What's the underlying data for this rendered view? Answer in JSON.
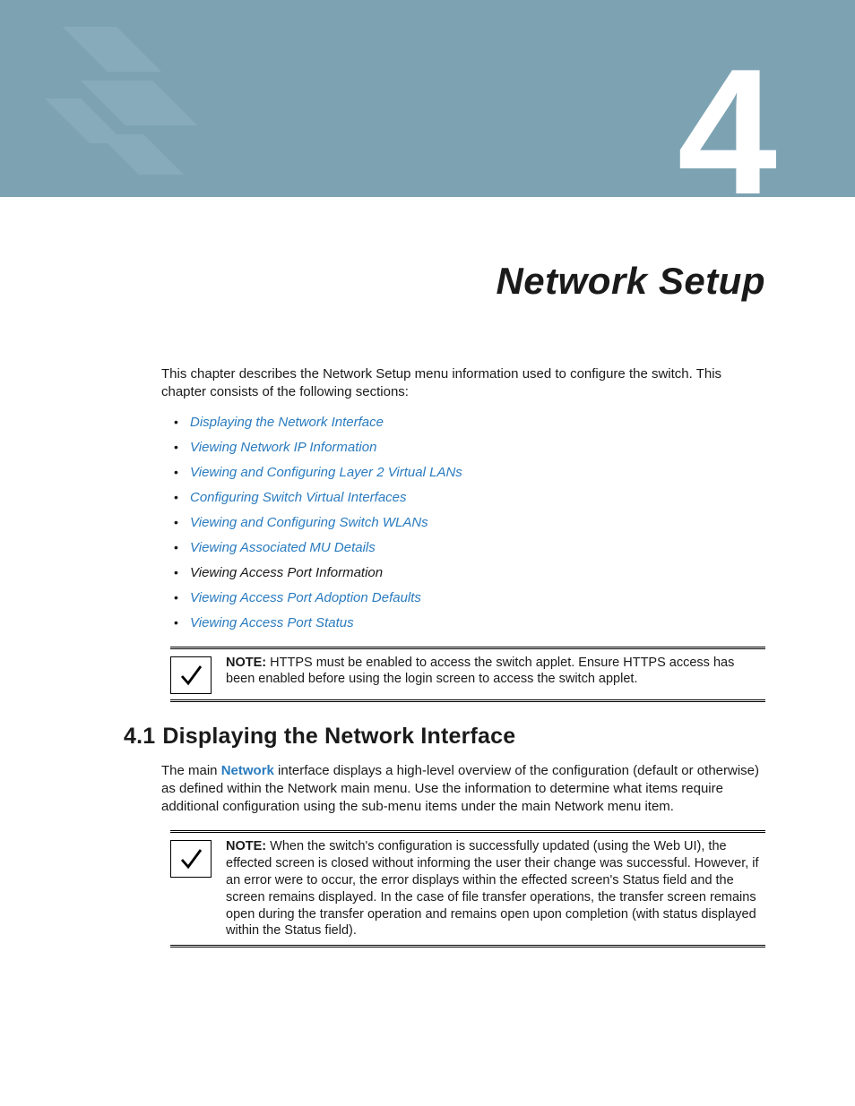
{
  "chapter": {
    "number": "4",
    "title": "Network Setup",
    "intro": "This chapter describes the Network Setup menu information used to configure the switch. This chapter consists of the following sections:"
  },
  "toc": [
    {
      "label": "Displaying the Network Interface",
      "link": true
    },
    {
      "label": "Viewing Network IP Information",
      "link": true
    },
    {
      "label": "Viewing and Configuring Layer 2 Virtual LANs",
      "link": true
    },
    {
      "label": "Configuring Switch Virtual Interfaces",
      "link": true
    },
    {
      "label": "Viewing and Configuring Switch WLANs",
      "link": true
    },
    {
      "label": "Viewing Associated MU Details",
      "link": true
    },
    {
      "label": "Viewing Access Port Information",
      "link": false
    },
    {
      "label": "Viewing Access Port Adoption Defaults",
      "link": true
    },
    {
      "label": "Viewing Access Port Status",
      "link": true
    }
  ],
  "note1": {
    "label": "NOTE:",
    "text": " HTTPS must be enabled to access the switch applet. Ensure HTTPS access has been enabled before using the login screen to access the switch applet."
  },
  "section41": {
    "number": "4.1",
    "title": "Displaying the Network Interface",
    "para_pre": "The main ",
    "para_kw": "Network",
    "para_post": " interface displays a high-level overview of the configuration (default or otherwise) as defined within the Network main menu. Use the information to determine what items require additional configuration using the sub-menu items under the main Network menu item."
  },
  "note2": {
    "label": "NOTE:",
    "text": " When the switch's configuration is successfully updated (using the Web UI), the effected screen is closed without informing the user their change was successful. However, if an error were to occur, the error displays within the effected screen's Status field and the screen remains displayed. In the case of file transfer operations, the transfer screen remains open during the transfer operation and remains open upon completion (with status displayed within the Status field)."
  }
}
